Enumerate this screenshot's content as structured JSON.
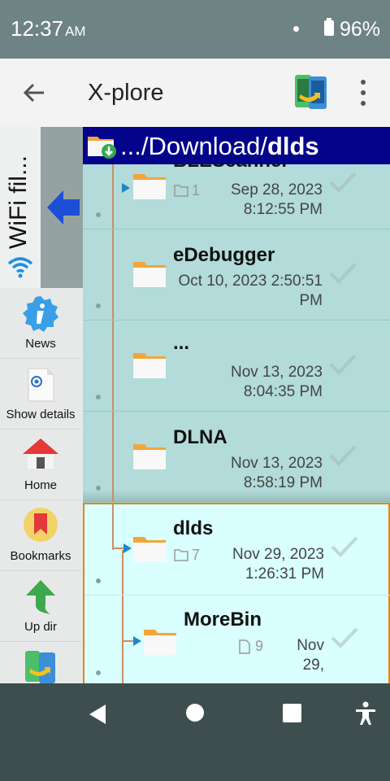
{
  "status": {
    "time": "12:37",
    "ampm": "AM",
    "battery": "96%"
  },
  "appbar": {
    "title": "X-plore"
  },
  "sidebar": {
    "wifi_label": "WiFi fil...",
    "items": [
      {
        "label": "News",
        "icon": "info-icon"
      },
      {
        "label": "Show details",
        "icon": "details-icon"
      },
      {
        "label": "Home",
        "icon": "home-icon"
      },
      {
        "label": "Bookmarks",
        "icon": "bookmark-icon"
      },
      {
        "label": "Up dir",
        "icon": "up-arrow-icon"
      }
    ]
  },
  "path": {
    "prefix": ".../Download/",
    "current": "dlds"
  },
  "files": [
    {
      "name": "BLEScanner",
      "count": "1",
      "date": "Sep 28, 2023",
      "time": "8:12:55 PM"
    },
    {
      "name": "eDebugger",
      "date": "Oct 10, 2023 2:50:51",
      "time": "PM"
    },
    {
      "name": "...",
      "date": "Nov 13, 2023",
      "time": "8:04:35 PM"
    },
    {
      "name": "DLNA",
      "date": "Nov 13, 2023",
      "time": "8:58:19 PM"
    },
    {
      "name": "dlds",
      "count": "7",
      "date": "Nov 29, 2023",
      "time": "1:26:31 PM"
    },
    {
      "name": "MoreBin",
      "count": "9",
      "date": "Nov",
      "time": "29,"
    }
  ],
  "colors": {
    "accent": "#04048b",
    "list_bg": "#b2dbd9",
    "selected_bg": "#d9ffff",
    "selected_border": "#e08a14"
  }
}
